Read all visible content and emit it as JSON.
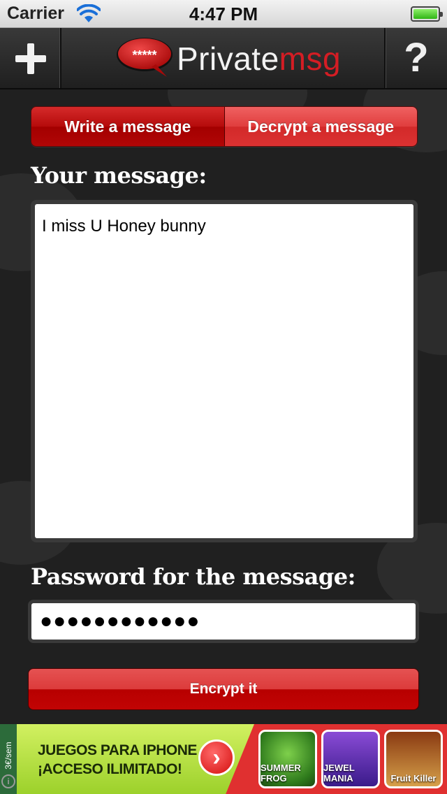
{
  "status_bar": {
    "carrier": "Carrier",
    "time": "4:47 PM"
  },
  "nav_bar": {
    "logo": {
      "bubble_text": "*****",
      "word_main": "Private",
      "word_accent": "msg"
    },
    "help_label": "?"
  },
  "tabs": [
    {
      "label": "Write a message",
      "active": true
    },
    {
      "label": "Decrypt a message",
      "active": false
    }
  ],
  "message": {
    "label": "Your message:",
    "value": "I miss U Honey bunny"
  },
  "password": {
    "label": "Password for the message:",
    "masked_value": "●●●●●●●●●●●●"
  },
  "encrypt_button": {
    "label": "Encrypt it"
  },
  "ad": {
    "price": "3€/sem",
    "line1": "JUEGOS PARA IPHONE",
    "line2": "¡ACCESO ILIMITADO!",
    "games": [
      "SUMMER FROG",
      "JEWEL MANIA",
      "Fruit Killer"
    ]
  },
  "colors": {
    "accent": "#d41d24",
    "tab_active": "#b50b0b",
    "tab_inactive": "#e03d3d",
    "background": "#202020"
  }
}
